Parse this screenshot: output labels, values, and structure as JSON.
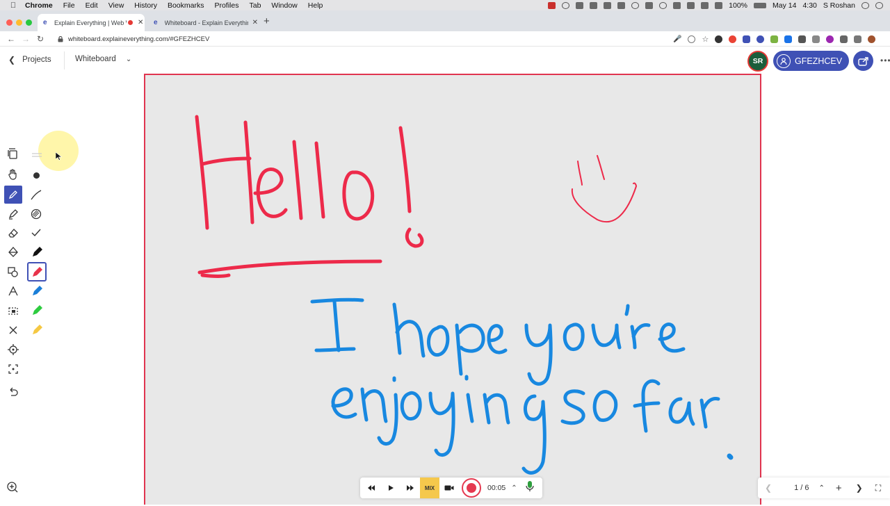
{
  "menubar": {
    "app": "Chrome",
    "items": [
      "File",
      "Edit",
      "View",
      "History",
      "Bookmarks",
      "Profiles",
      "Tab",
      "Window",
      "Help"
    ],
    "battery": "100%",
    "date": "May 14",
    "time": "4:30",
    "user": "S Roshan"
  },
  "browser": {
    "tabs": [
      {
        "title": "Explain Everything | Web W",
        "recording": true
      },
      {
        "title": "Whiteboard - Explain Everythin",
        "recording": false
      }
    ],
    "url": "whiteboard.explaineverything.com/#GFEZHCEV"
  },
  "header": {
    "back_label": "Projects",
    "board_title": "Whiteboard",
    "avatar_initials": "SR",
    "session_code": "GFEZHCEV"
  },
  "canvas": {
    "accent_red": "#ed2a4a",
    "accent_blue": "#1888e0",
    "background": "#e8e8e8"
  },
  "toolbar": {
    "tools": [
      "select-icon",
      "hand-icon",
      "pen-icon",
      "highlighter-icon",
      "eraser-icon",
      "fill-icon",
      "shapes-icon",
      "text-icon",
      "lasso-icon",
      "close-icon",
      "laser-icon",
      "crop-icon",
      "undo-icon"
    ],
    "swatches": [
      "#111111",
      "#e8334a",
      "#1a7ed8",
      "#2ecc40",
      "#f5c842"
    ]
  },
  "player": {
    "mix_label": "MIX",
    "elapsed": "00:05"
  },
  "pager": {
    "label": "1 / 6"
  }
}
